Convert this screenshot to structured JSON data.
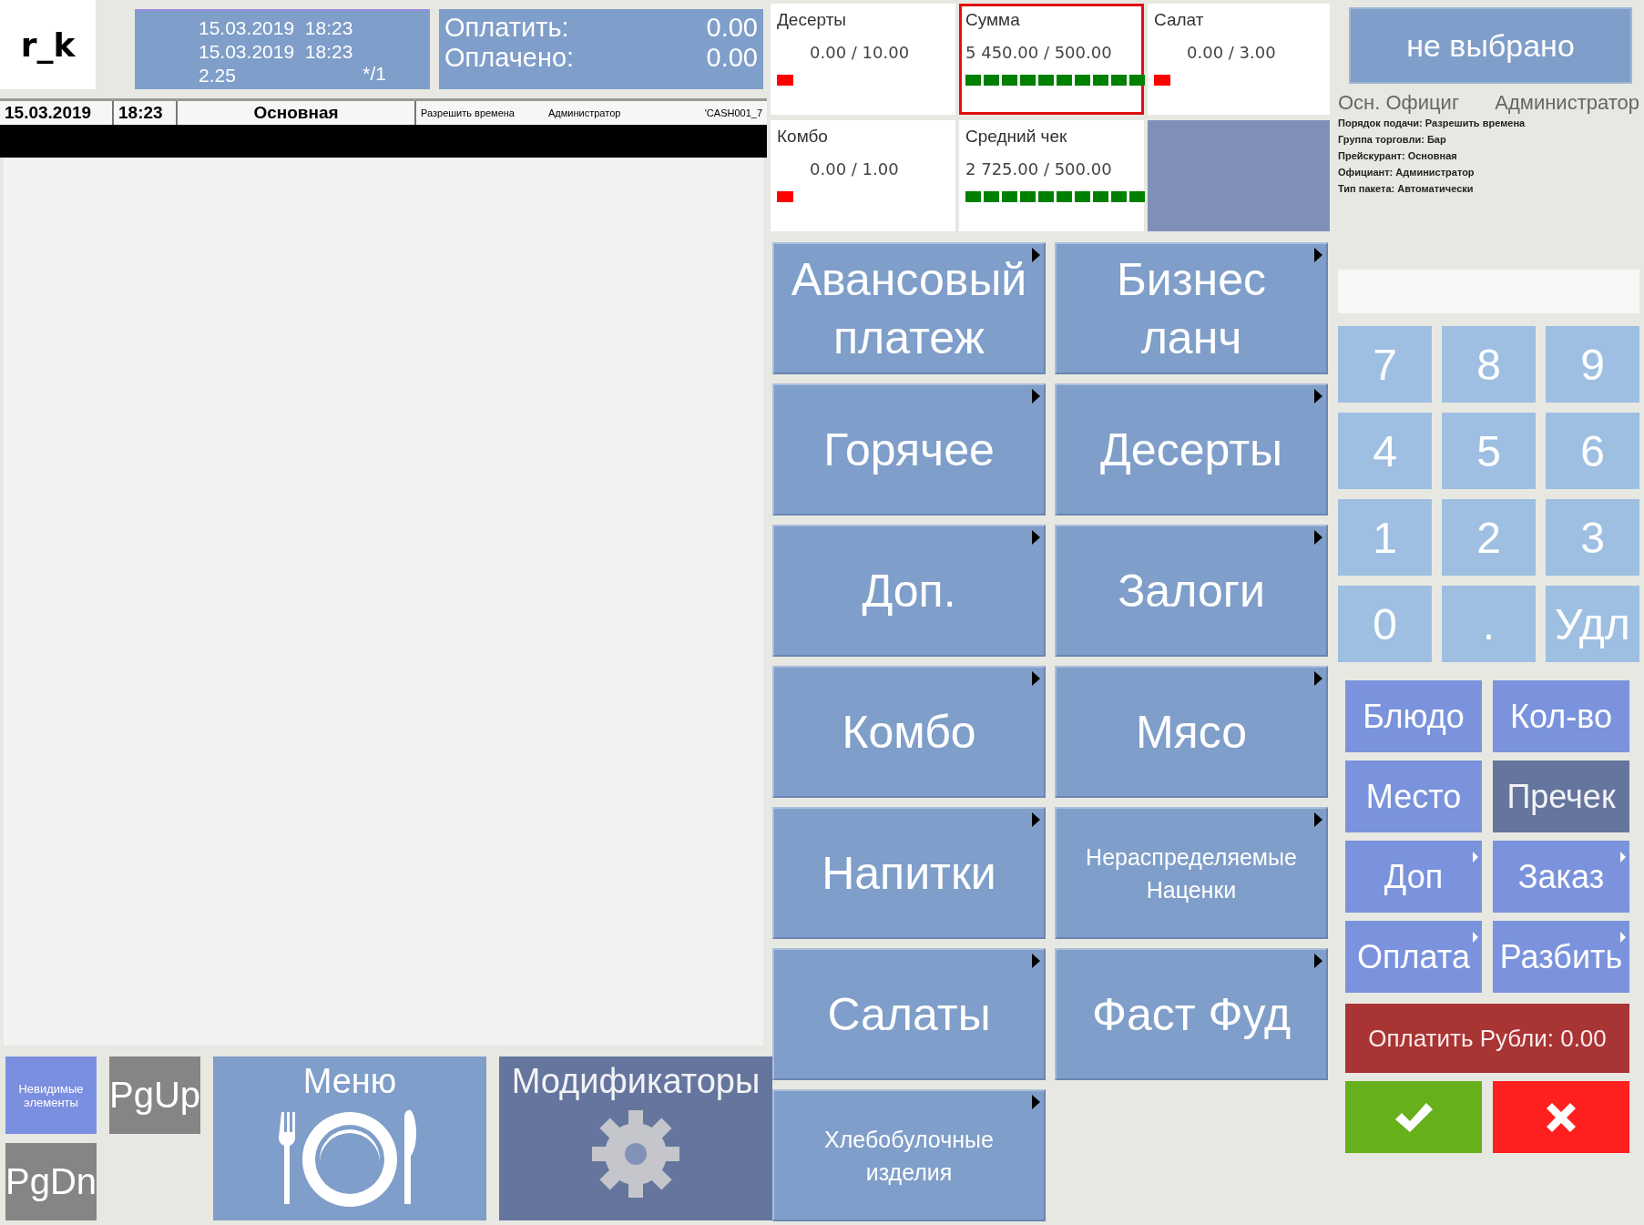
{
  "header": {
    "logo": "r_k",
    "order_times": [
      "15.03.2019  18:23",
      "15.03.2019  18:23"
    ],
    "guests": "2.25",
    "table": "*/1",
    "payment": [
      {
        "label": "Оплатить:",
        "value": "0.00"
      },
      {
        "label": "Оплачено:",
        "value": "0.00"
      }
    ]
  },
  "status_strip": {
    "date": "15.03.2019",
    "time": "18:23",
    "price_list": "Основная",
    "serving_order": "Разрешить времена",
    "waiter": "Администратор",
    "station": "'CASH001_7"
  },
  "kpis": [
    {
      "label": "Десерты",
      "value": "0.00 / 10.00",
      "level": 0,
      "selected": false
    },
    {
      "label": "Сумма",
      "value": "5 450.00 / 500.00",
      "level": 1,
      "selected": true
    },
    {
      "label": "Салат",
      "value": "0.00 / 3.00",
      "level": 0,
      "selected": false
    },
    {
      "label": "Комбо",
      "value": "0.00 / 1.00",
      "level": 0,
      "selected": false
    },
    {
      "label": "Средний чек",
      "value": "2 725.00 / 500.00",
      "level": 1,
      "selected": false
    }
  ],
  "categories": [
    {
      "label": "Авансовый платеж",
      "submenu": true
    },
    {
      "label": "Бизнес ланч",
      "submenu": true
    },
    {
      "label": "Горячее",
      "submenu": true
    },
    {
      "label": "Десерты",
      "submenu": true
    },
    {
      "label": "Доп.",
      "submenu": true
    },
    {
      "label": "Залоги",
      "submenu": true
    },
    {
      "label": "Комбо",
      "submenu": true
    },
    {
      "label": "Мясо",
      "submenu": true
    },
    {
      "label": "Напитки",
      "submenu": true
    },
    {
      "label": "Нераспределяемые Наценки",
      "submenu": true
    },
    {
      "label": "Салаты",
      "submenu": true
    },
    {
      "label": "Фаст Фуд",
      "submenu": true
    },
    {
      "label": "Хлебобулочные изделия",
      "submenu": true
    }
  ],
  "bottom": [
    {
      "kind": "hidden",
      "label": "Невидимые элементы",
      "disabled": false
    },
    {
      "kind": "pgup",
      "label": "PgUp",
      "disabled": false
    },
    {
      "kind": "pgdn",
      "label": "PgDn",
      "disabled": false
    },
    {
      "kind": "menu",
      "label": "Меню",
      "disabled": false
    },
    {
      "kind": "modifiers",
      "label": "Модификаторы",
      "disabled": true
    }
  ],
  "right": {
    "customer": "не выбрано",
    "waiter_short": "Осн. Официг",
    "waiter": "Администратор",
    "details": [
      "Порядок подачи: Разрешить времена",
      "Группа торговли: Бар",
      "Прейскурант: Основная",
      "Официант: Администратор",
      "Тип пакета: Автоматически"
    ]
  },
  "keypad": [
    "7",
    "8",
    "9",
    "4",
    "5",
    "6",
    "1",
    "2",
    "3",
    "0",
    ".",
    "Удл"
  ],
  "actions": [
    {
      "label": "Блюдо",
      "submenu": false,
      "disabled": false
    },
    {
      "label": "Кол-во",
      "submenu": false,
      "disabled": false
    },
    {
      "label": "Место",
      "submenu": false,
      "disabled": false
    },
    {
      "label": "Пречек",
      "submenu": false,
      "disabled": true
    },
    {
      "label": "Доп",
      "submenu": true,
      "disabled": false
    },
    {
      "label": "Заказ",
      "submenu": true,
      "disabled": false
    },
    {
      "label": "Оплата",
      "submenu": true,
      "disabled": false
    },
    {
      "label": "Разбить",
      "submenu": true,
      "disabled": false
    }
  ],
  "pay_button": {
    "label": "Оплатить Рубли: 0.00",
    "disabled": true
  }
}
